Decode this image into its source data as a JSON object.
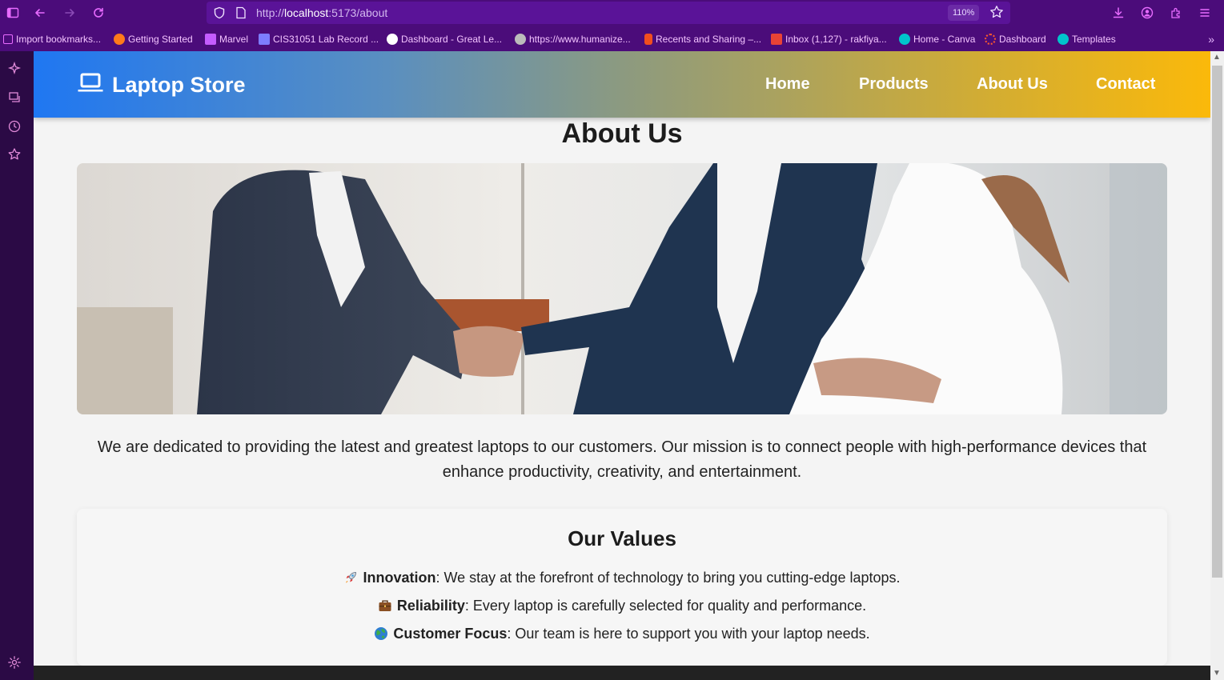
{
  "browser": {
    "url_prefix": "http://",
    "url_host": "localhost",
    "url_path": ":5173/about",
    "zoom": "110%",
    "bookmarks": [
      {
        "label": "Import bookmarks...",
        "color": "#e86bff"
      },
      {
        "label": "Getting Started",
        "color": "#ff7a1a"
      },
      {
        "label": "Marvel",
        "color": "#c45cff"
      },
      {
        "label": "CIS31051 Lab Record ...",
        "color": "#7d7dff"
      },
      {
        "label": "Dashboard - Great Le...",
        "color": "#ffffff"
      },
      {
        "label": "https://www.humanize...",
        "color": "#bbbbbb"
      },
      {
        "label": "Recents and Sharing –...",
        "color": "#f24e1e"
      },
      {
        "label": "Inbox (1,127) - rakfiya...",
        "color": "#ea4335"
      },
      {
        "label": "Home - Canva",
        "color": "#00c4cc"
      },
      {
        "label": "Dashboard",
        "color": "#ff5a2c"
      },
      {
        "label": "Templates",
        "color": "#00c4cc"
      }
    ]
  },
  "site": {
    "brand": "Laptop Store",
    "nav": [
      "Home",
      "Products",
      "About Us",
      "Contact"
    ],
    "page_title": "About Us",
    "mission": "We are dedicated to providing the latest and greatest laptops to our customers. Our mission is to connect people with high-performance devices that enhance productivity, creativity, and entertainment.",
    "values_title": "Our Values",
    "values": [
      {
        "emoji": "rocket-icon",
        "name": "Innovation",
        "text": ": We stay at the forefront of technology to bring you cutting-edge laptops."
      },
      {
        "emoji": "briefcase-icon",
        "name": "Reliability",
        "text": ": Every laptop is carefully selected for quality and performance."
      },
      {
        "emoji": "globe-icon",
        "name": "Customer Focus",
        "text": ": Our team is here to support you with your laptop needs."
      }
    ]
  },
  "colors": {
    "chrome_bg": "#4b0c7a",
    "accent_pink": "#e18bd9",
    "nav_gradient_start": "#1f77f2",
    "nav_gradient_end": "#fbb90a"
  }
}
